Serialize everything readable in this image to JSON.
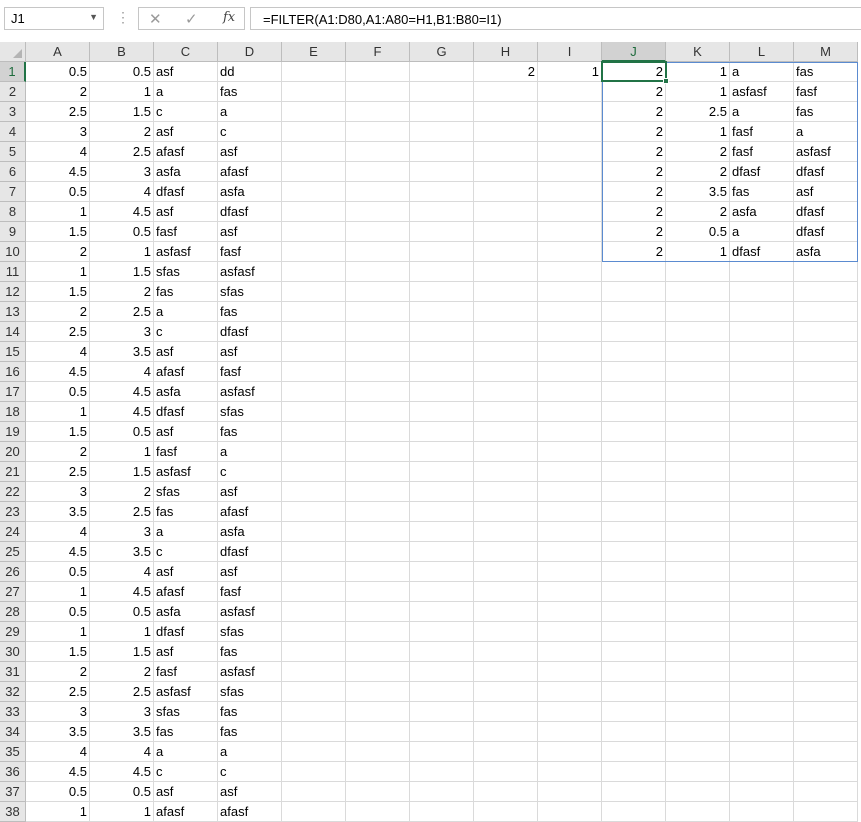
{
  "formula_bar": {
    "name_box": "J1",
    "formula": "=FILTER(A1:D80,A1:A80=H1,B1:B80=I1)"
  },
  "columns": [
    "A",
    "B",
    "C",
    "D",
    "E",
    "F",
    "G",
    "H",
    "I",
    "J",
    "K",
    "L",
    "M"
  ],
  "selected_column": "J",
  "selected_row": 1,
  "rows": [
    [
      "1",
      "0.5",
      "0.5",
      "asf",
      "dd",
      "",
      "",
      "",
      "2",
      "1",
      "2",
      "1",
      "a",
      "fas"
    ],
    [
      "2",
      "2",
      "1",
      "a",
      "fas",
      "",
      "",
      "",
      "",
      "",
      "2",
      "1",
      "asfasf",
      "fasf"
    ],
    [
      "3",
      "2.5",
      "1.5",
      "c",
      "a",
      "",
      "",
      "",
      "",
      "",
      "2",
      "2.5",
      "a",
      "fas"
    ],
    [
      "4",
      "3",
      "2",
      "asf",
      "c",
      "",
      "",
      "",
      "",
      "",
      "2",
      "1",
      "fasf",
      "a"
    ],
    [
      "5",
      "4",
      "2.5",
      "afasf",
      "asf",
      "",
      "",
      "",
      "",
      "",
      "2",
      "2",
      "fasf",
      "asfasf"
    ],
    [
      "6",
      "4.5",
      "3",
      "asfa",
      "afasf",
      "",
      "",
      "",
      "",
      "",
      "2",
      "2",
      "dfasf",
      "dfasf"
    ],
    [
      "7",
      "0.5",
      "4",
      "dfasf",
      "asfa",
      "",
      "",
      "",
      "",
      "",
      "2",
      "3.5",
      "fas",
      "asf"
    ],
    [
      "8",
      "1",
      "4.5",
      "asf",
      "dfasf",
      "",
      "",
      "",
      "",
      "",
      "2",
      "2",
      "asfa",
      "dfasf"
    ],
    [
      "9",
      "1.5",
      "0.5",
      "fasf",
      "asf",
      "",
      "",
      "",
      "",
      "",
      "2",
      "0.5",
      "a",
      "dfasf"
    ],
    [
      "10",
      "2",
      "1",
      "asfasf",
      "fasf",
      "",
      "",
      "",
      "",
      "",
      "2",
      "1",
      "dfasf",
      "asfa"
    ],
    [
      "11",
      "1",
      "1.5",
      "sfas",
      "asfasf",
      "",
      "",
      "",
      "",
      "",
      "",
      "",
      "",
      ""
    ],
    [
      "12",
      "1.5",
      "2",
      "fas",
      "sfas",
      "",
      "",
      "",
      "",
      "",
      "",
      "",
      "",
      ""
    ],
    [
      "13",
      "2",
      "2.5",
      "a",
      "fas",
      "",
      "",
      "",
      "",
      "",
      "",
      "",
      "",
      ""
    ],
    [
      "14",
      "2.5",
      "3",
      "c",
      "dfasf",
      "",
      "",
      "",
      "",
      "",
      "",
      "",
      "",
      ""
    ],
    [
      "15",
      "4",
      "3.5",
      "asf",
      "asf",
      "",
      "",
      "",
      "",
      "",
      "",
      "",
      "",
      ""
    ],
    [
      "16",
      "4.5",
      "4",
      "afasf",
      "fasf",
      "",
      "",
      "",
      "",
      "",
      "",
      "",
      "",
      ""
    ],
    [
      "17",
      "0.5",
      "4.5",
      "asfa",
      "asfasf",
      "",
      "",
      "",
      "",
      "",
      "",
      "",
      "",
      ""
    ],
    [
      "18",
      "1",
      "4.5",
      "dfasf",
      "sfas",
      "",
      "",
      "",
      "",
      "",
      "",
      "",
      "",
      ""
    ],
    [
      "19",
      "1.5",
      "0.5",
      "asf",
      "fas",
      "",
      "",
      "",
      "",
      "",
      "",
      "",
      "",
      ""
    ],
    [
      "20",
      "2",
      "1",
      "fasf",
      "a",
      "",
      "",
      "",
      "",
      "",
      "",
      "",
      "",
      ""
    ],
    [
      "21",
      "2.5",
      "1.5",
      "asfasf",
      "c",
      "",
      "",
      "",
      "",
      "",
      "",
      "",
      "",
      ""
    ],
    [
      "22",
      "3",
      "2",
      "sfas",
      "asf",
      "",
      "",
      "",
      "",
      "",
      "",
      "",
      "",
      ""
    ],
    [
      "23",
      "3.5",
      "2.5",
      "fas",
      "afasf",
      "",
      "",
      "",
      "",
      "",
      "",
      "",
      "",
      ""
    ],
    [
      "24",
      "4",
      "3",
      "a",
      "asfa",
      "",
      "",
      "",
      "",
      "",
      "",
      "",
      "",
      ""
    ],
    [
      "25",
      "4.5",
      "3.5",
      "c",
      "dfasf",
      "",
      "",
      "",
      "",
      "",
      "",
      "",
      "",
      ""
    ],
    [
      "26",
      "0.5",
      "4",
      "asf",
      "asf",
      "",
      "",
      "",
      "",
      "",
      "",
      "",
      "",
      ""
    ],
    [
      "27",
      "1",
      "4.5",
      "afasf",
      "fasf",
      "",
      "",
      "",
      "",
      "",
      "",
      "",
      "",
      ""
    ],
    [
      "28",
      "0.5",
      "0.5",
      "asfa",
      "asfasf",
      "",
      "",
      "",
      "",
      "",
      "",
      "",
      "",
      ""
    ],
    [
      "29",
      "1",
      "1",
      "dfasf",
      "sfas",
      "",
      "",
      "",
      "",
      "",
      "",
      "",
      "",
      ""
    ],
    [
      "30",
      "1.5",
      "1.5",
      "asf",
      "fas",
      "",
      "",
      "",
      "",
      "",
      "",
      "",
      "",
      ""
    ],
    [
      "31",
      "2",
      "2",
      "fasf",
      "asfasf",
      "",
      "",
      "",
      "",
      "",
      "",
      "",
      "",
      ""
    ],
    [
      "32",
      "2.5",
      "2.5",
      "asfasf",
      "sfas",
      "",
      "",
      "",
      "",
      "",
      "",
      "",
      "",
      ""
    ],
    [
      "33",
      "3",
      "3",
      "sfas",
      "fas",
      "",
      "",
      "",
      "",
      "",
      "",
      "",
      "",
      ""
    ],
    [
      "34",
      "3.5",
      "3.5",
      "fas",
      "fas",
      "",
      "",
      "",
      "",
      "",
      "",
      "",
      "",
      ""
    ],
    [
      "35",
      "4",
      "4",
      "a",
      "a",
      "",
      "",
      "",
      "",
      "",
      "",
      "",
      "",
      ""
    ],
    [
      "36",
      "4.5",
      "4.5",
      "c",
      "c",
      "",
      "",
      "",
      "",
      "",
      "",
      "",
      "",
      ""
    ],
    [
      "37",
      "0.5",
      "0.5",
      "asf",
      "asf",
      "",
      "",
      "",
      "",
      "",
      "",
      "",
      "",
      ""
    ],
    [
      "38",
      "1",
      "1",
      "afasf",
      "afasf",
      "",
      "",
      "",
      "",
      "",
      "",
      "",
      "",
      ""
    ]
  ]
}
